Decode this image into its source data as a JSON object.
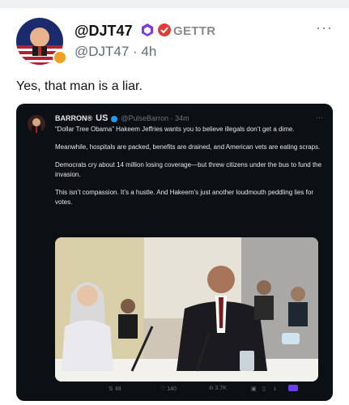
{
  "post": {
    "author": {
      "display_name": "@DJT47",
      "handle_time": "@DJT47 · 4h",
      "platform": "GETTR"
    },
    "more_menu": "···",
    "text": "Yes, that man is a liar."
  },
  "embed": {
    "author_name": "BARRON®",
    "flag_text": "US",
    "meta": "@PulseBarron · 34m",
    "more": "···",
    "paragraphs": [
      "“Dollar Tree Obama” Hakeem Jeffries wants you to believe illegals don’t get a dime.",
      "Meanwhile, hospitals are packed, benefits are drained, and American vets are eating scraps.",
      "Democrats cry about 14 million losing coverage—but threw citizens under the bus to fund the invasion.",
      "This isn’t compassion. It’s a hustle. And Hakeem’s just another loudmouth peddling lies for votes."
    ],
    "stats": {
      "replies": "48",
      "likes": "140",
      "views": "3.7K"
    },
    "colors": {
      "background": "#0b1015",
      "text": "#e7e9ea",
      "muted": "#71767b",
      "accent": "#1d9bf0"
    }
  }
}
